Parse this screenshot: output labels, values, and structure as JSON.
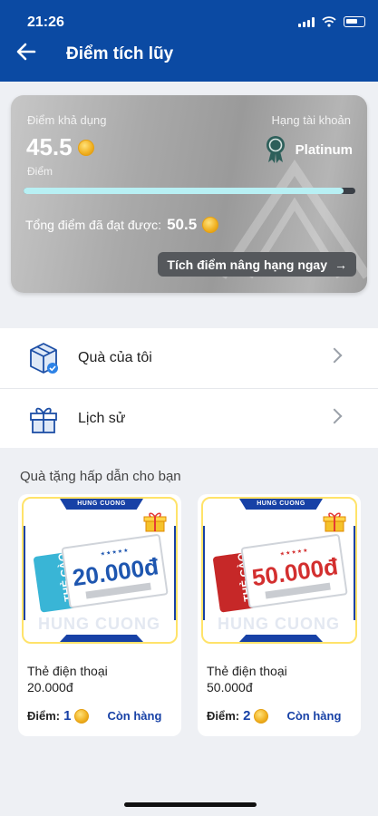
{
  "status_bar": {
    "time": "21:26"
  },
  "header": {
    "title": "Điểm tích lũy"
  },
  "points_card": {
    "available_label": "Điểm khả dụng",
    "available_points": "45.5",
    "unit_label": "Điểm",
    "rank_label": "Hạng tài khoản",
    "rank_name": "Platinum",
    "progress_fraction": 0.965,
    "total_label": "Tổng điểm đã đạt được:",
    "total_points": "50.5",
    "upgrade_button": "Tích điểm nâng hạng ngay"
  },
  "menu": [
    {
      "label": "Quà của tôi",
      "icon": "gift-box-icon"
    },
    {
      "label": "Lịch sử",
      "icon": "gift-icon"
    }
  ],
  "section_title": "Quà tặng hấp dẫn cho bạn",
  "gifts": [
    {
      "brand": "HUNG CUONG",
      "watermark": "HUNG CUONG",
      "voucher_tag": "THẺ CÀO",
      "voucher_amount": "20.000đ",
      "name_line1": "Thẻ điện thoại",
      "name_line2": "20.000đ",
      "points_label": "Điểm:",
      "points": "1",
      "stock": "Còn hàng",
      "accent": "#39b5d6",
      "amount_color": "#1e56b0"
    },
    {
      "brand": "HUNG CUONG",
      "watermark": "HUNG CUONG",
      "voucher_tag": "THẺ CÀO",
      "voucher_amount": "50.000đ",
      "name_line1": "Thẻ điện thoại",
      "name_line2": "50.000đ",
      "points_label": "Điểm:",
      "points": "2",
      "stock": "Còn hàng",
      "accent": "#c62828",
      "amount_color": "#d32f2f"
    }
  ],
  "colors": {
    "header": "#0b4aa3",
    "link": "#1741a6",
    "progress": "#b8f0f4"
  }
}
